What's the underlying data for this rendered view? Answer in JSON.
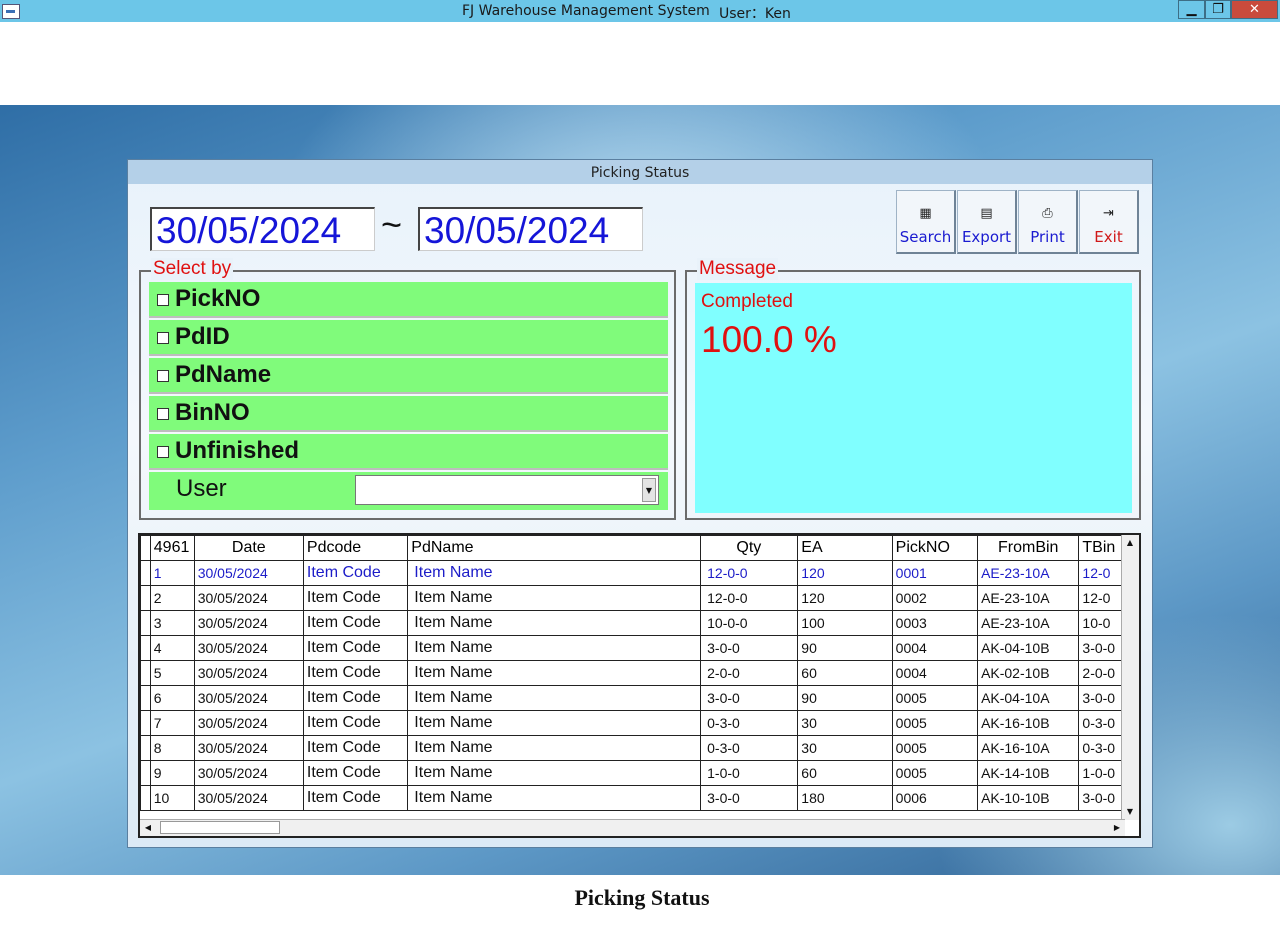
{
  "window": {
    "title": "FJ Warehouse Management System",
    "user_label": "User：Ken",
    "min_icon": "minimize-icon",
    "max_icon": "restore-icon",
    "close_icon": "close-icon"
  },
  "dialog": {
    "title": "Picking Status",
    "date_from": "30/05/2024",
    "date_sep": "~",
    "date_to": "30/05/2024",
    "toolbar": [
      {
        "label": "Search",
        "icon": "binoculars-icon"
      },
      {
        "label": "Export",
        "icon": "spreadsheet-icon"
      },
      {
        "label": "Print",
        "icon": "printer-icon"
      },
      {
        "label": "Exit",
        "icon": "exit-door-icon"
      }
    ],
    "select_by": {
      "legend": "Select by",
      "options": [
        "PickNO",
        "PdID",
        "PdName",
        "BinNO",
        "Unfinished"
      ],
      "user_label": "User",
      "user_value": ""
    },
    "message": {
      "legend": "Message",
      "status": "Completed",
      "percent": "100.0 %"
    }
  },
  "grid": {
    "row_count": "4961",
    "columns": [
      "Date",
      "Pdcode",
      "PdName",
      "Qty",
      "EA",
      "PickNO",
      "FromBin",
      "TBin"
    ],
    "rows": [
      [
        "1",
        "30/05/2024",
        "Item Code",
        "Item Name",
        "12-0-0",
        "120",
        "0001",
        "AE-23-10A",
        "12-0"
      ],
      [
        "2",
        "30/05/2024",
        "Item Code",
        "Item Name",
        "12-0-0",
        "120",
        "0002",
        "AE-23-10A",
        "12-0"
      ],
      [
        "3",
        "30/05/2024",
        "Item Code",
        "Item Name",
        "10-0-0",
        "100",
        "0003",
        "AE-23-10A",
        "10-0"
      ],
      [
        "4",
        "30/05/2024",
        "Item Code",
        "Item Name",
        "3-0-0",
        "90",
        "0004",
        "AK-04-10B",
        "3-0-0"
      ],
      [
        "5",
        "30/05/2024",
        "Item Code",
        "Item Name",
        "2-0-0",
        "60",
        "0004",
        "AK-02-10B",
        "2-0-0"
      ],
      [
        "6",
        "30/05/2024",
        "Item Code",
        "Item Name",
        "3-0-0",
        "90",
        "0005",
        "AK-04-10A",
        "3-0-0"
      ],
      [
        "7",
        "30/05/2024",
        "Item Code",
        "Item Name",
        "0-3-0",
        "30",
        "0005",
        "AK-16-10B",
        "0-3-0"
      ],
      [
        "8",
        "30/05/2024",
        "Item Code",
        "Item Name",
        "0-3-0",
        "30",
        "0005",
        "AK-16-10A",
        "0-3-0"
      ],
      [
        "9",
        "30/05/2024",
        "Item Code",
        "Item Name",
        "1-0-0",
        "60",
        "0005",
        "AK-14-10B",
        "1-0-0"
      ],
      [
        "10",
        "30/05/2024",
        "Item Code",
        "Item Name",
        "3-0-0",
        "180",
        "0006",
        "AK-10-10B",
        "3-0-0"
      ]
    ]
  },
  "caption": "Picking Status",
  "colors": {
    "titlebar": "#6cc6e8",
    "option_green": "#80fb7b",
    "message_cyan": "#80ffff",
    "accent_red": "#e01010",
    "date_blue": "#1515d8"
  }
}
